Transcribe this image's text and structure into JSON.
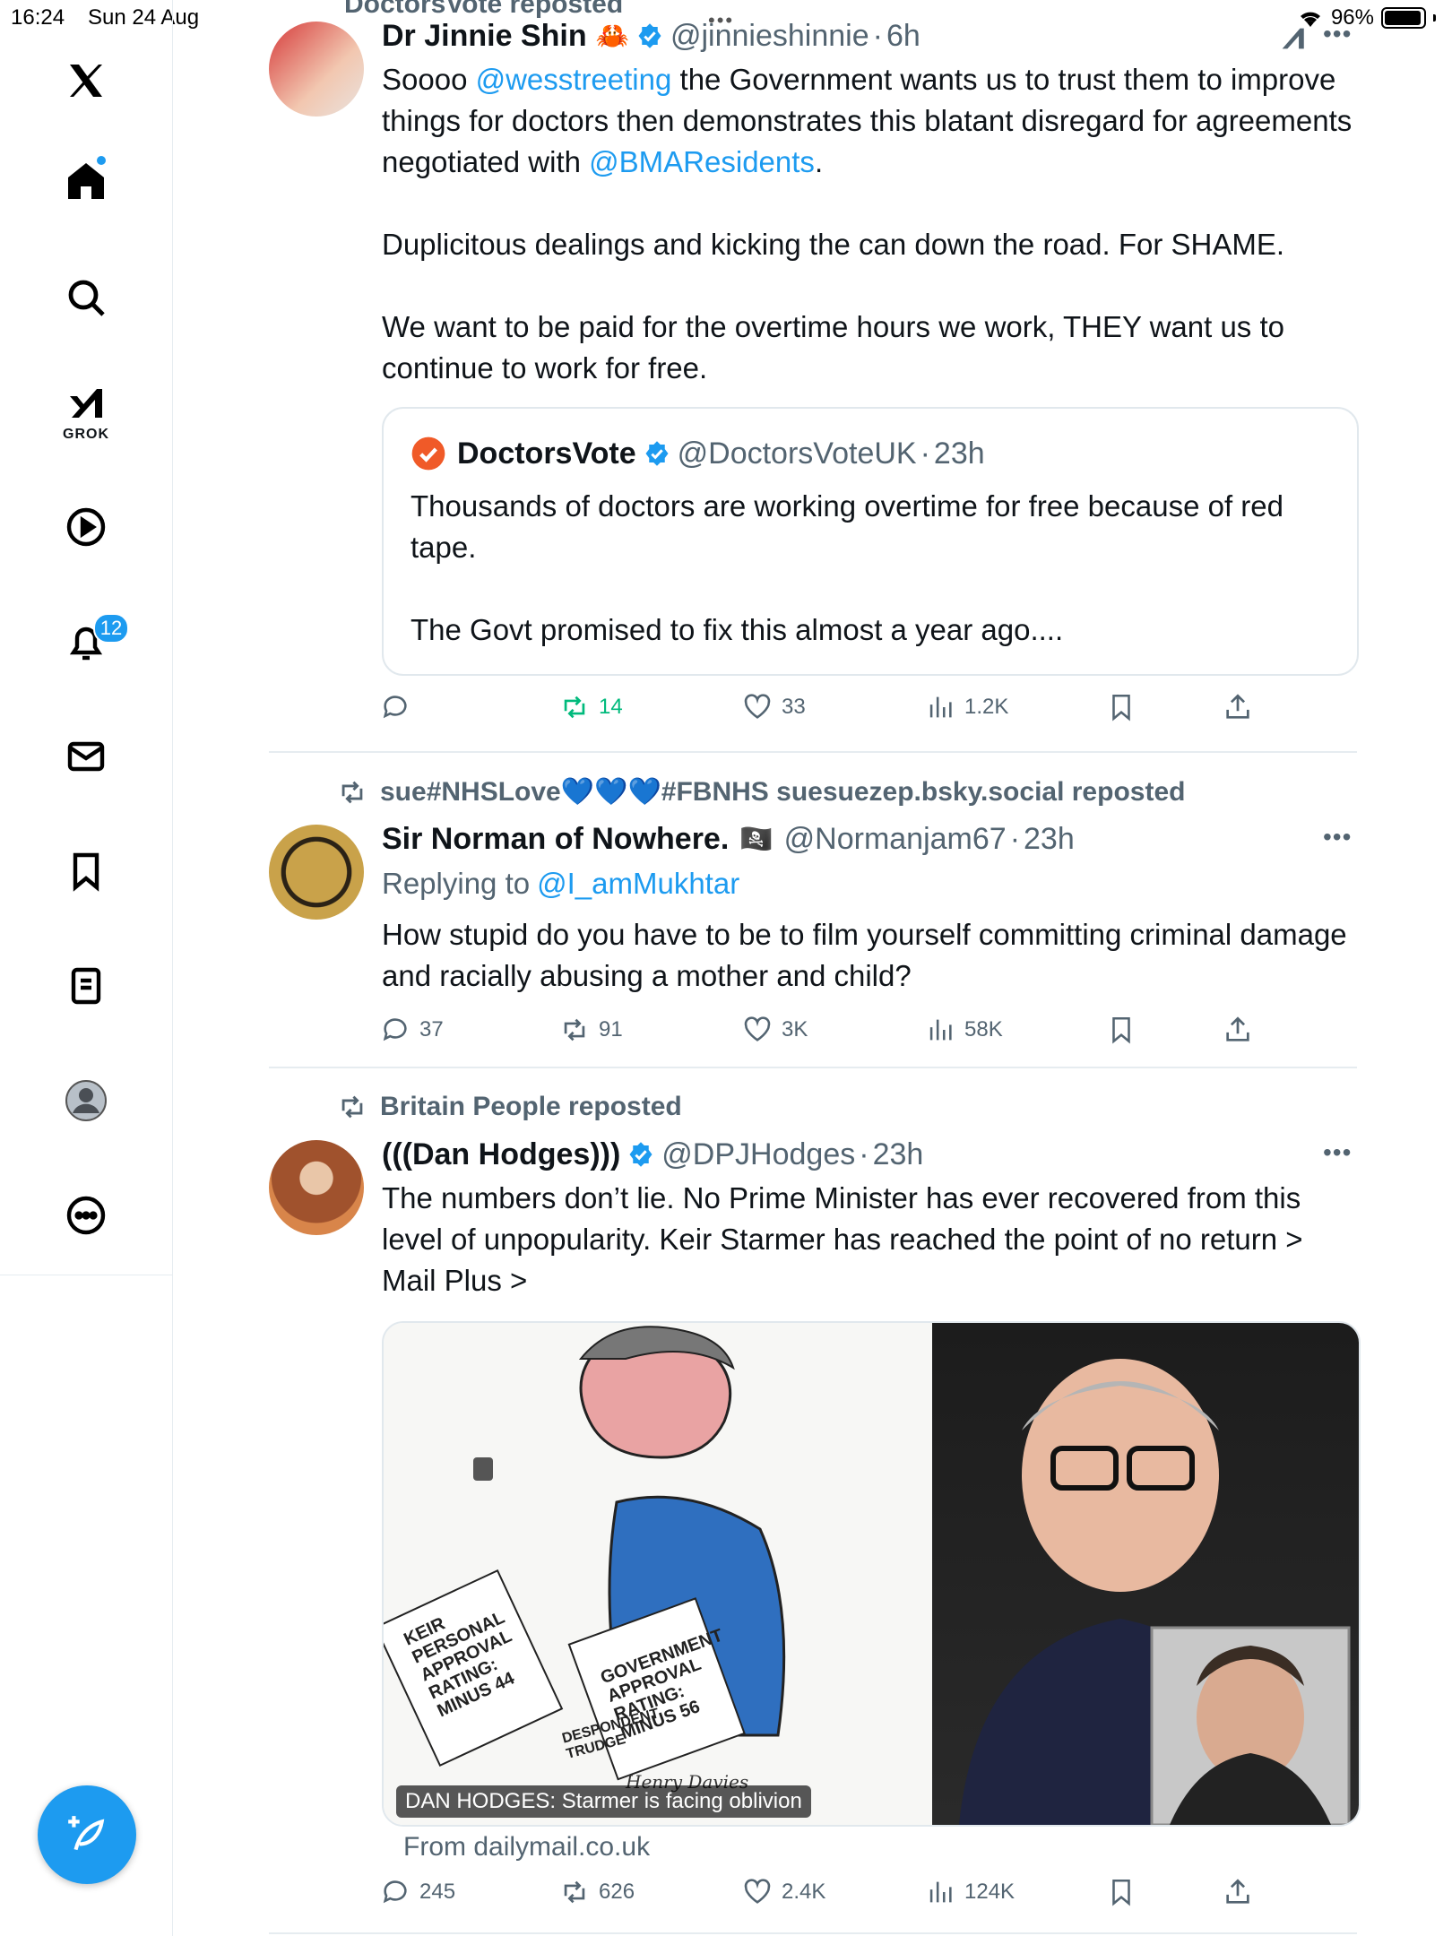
{
  "status": {
    "time": "16:24",
    "date": "Sun 24 Aug",
    "battery": "96%"
  },
  "colors": {
    "accent": "#1d9bf0",
    "repost_green": "#00ba7c",
    "text": "#0f1419",
    "muted": "#536471"
  },
  "sidebar": {
    "items": [
      {
        "name": "x-logo-icon"
      },
      {
        "name": "home-icon"
      },
      {
        "name": "search-icon"
      },
      {
        "name": "grok-icon",
        "label": "GROK"
      },
      {
        "name": "video-icon"
      },
      {
        "name": "notifications-icon",
        "badge": "12"
      },
      {
        "name": "messages-icon"
      },
      {
        "name": "bookmarks-icon"
      },
      {
        "name": "lists-icon"
      },
      {
        "name": "profile-icon"
      },
      {
        "name": "more-icon"
      }
    ]
  },
  "tweet1": {
    "repost_banner": "DoctorsVote reposted",
    "name": "Dr Jinnie Shin",
    "emoji": "🦀",
    "handle": "@jinnieshinnie",
    "time": "6h",
    "text": {
      "p1_a": "Soooo ",
      "p1_mention1": "@wesstreeting",
      "p1_b": " the Government wants us to trust them to improve things for doctors then demonstrates this blatant disregard for agreements negotiated with ",
      "p1_mention2": "@BMAResidents",
      "p1_c": ".",
      "p2": "Duplicitous dealings and kicking the can down the road. For SHAME.",
      "p3": "We want to be paid for the overtime hours we work, THEY want us to continue to work for free."
    },
    "quote": {
      "name": "DoctorsVote",
      "handle": "@DoctorsVoteUK",
      "time": "23h",
      "p1": "Thousands of doctors are working overtime for free because of red tape.",
      "p2": "The Govt promised to fix this almost a year ago...."
    },
    "actions": {
      "replies": "",
      "reposts": "14",
      "likes": "33",
      "views": "1.2K"
    }
  },
  "tweet2": {
    "repost_banner": "sue#NHSLove💙💙💙#FBNHS suesuezep.bsky.social reposted",
    "name": "Sir Norman of Nowhere.",
    "emoji": "🏴‍☠️",
    "handle": "@Normanjam67",
    "time": "23h",
    "replying_prefix": "Replying to ",
    "replying_to": "@I_amMukhtar",
    "text": "How stupid do you have to be to film yourself committing criminal damage and racially abusing a mother and child?",
    "actions": {
      "replies": "37",
      "reposts": "91",
      "likes": "3K",
      "views": "58K"
    }
  },
  "tweet3": {
    "repost_banner": "Britain People reposted",
    "name": "(((Dan Hodges)))",
    "handle": "@DPJHodges",
    "time": "23h",
    "text": "The numbers don’t lie. No Prime Minister has ever recovered from this level of unpopularity. Keir Starmer has reached the point of no return  >  Mail Plus  >",
    "media_caption": "DAN HODGES: Starmer is facing oblivion",
    "cartoon_labels": {
      "left": "KEIR PERSONAL APPROVAL RATING: MINUS 44",
      "right": "GOVERNMENT APPROVAL RATING: MINUS 56",
      "footer": "DESPONDENT TRUDGE",
      "signature": "Henry Davies"
    },
    "source": "From dailymail.co.uk",
    "actions": {
      "replies": "245",
      "reposts": "626",
      "likes": "2.4K",
      "views": "124K"
    }
  },
  "dot": "·"
}
